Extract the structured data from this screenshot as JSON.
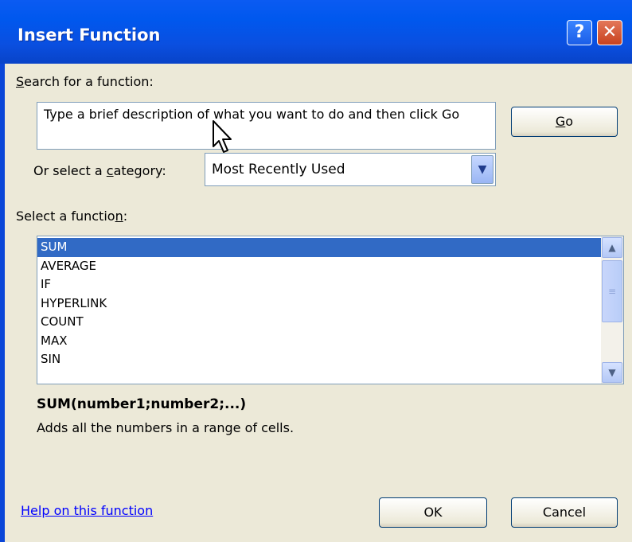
{
  "window": {
    "title": "Insert Function",
    "help_glyph": "?",
    "close_glyph": "✕"
  },
  "search": {
    "label_prefix": "",
    "label_hotkey": "S",
    "label_rest": "earch for a function:",
    "value": "Type a brief description of what you want to do and then click Go"
  },
  "go_button": {
    "hotkey": "G",
    "rest": "o"
  },
  "category": {
    "label_prefix": "Or select a ",
    "label_hotkey": "c",
    "label_rest": "ategory:",
    "selected": "Most Recently Used"
  },
  "function_list": {
    "label_prefix": "Select a functio",
    "label_hotkey": "n",
    "label_rest": ":",
    "items": [
      "SUM",
      "AVERAGE",
      "IF",
      "HYPERLINK",
      "COUNT",
      "MAX",
      "SIN"
    ],
    "selected_index": 0
  },
  "details": {
    "syntax": "SUM(number1;number2;...)",
    "description": "Adds all the numbers in a range of cells."
  },
  "footer": {
    "help_link": "Help on this function",
    "ok_label": "OK",
    "cancel_label": "Cancel"
  },
  "icons": {
    "dropdown": "chevron-down-icon",
    "scroll_up": "chevron-up-icon",
    "scroll_down": "chevron-down-icon",
    "cursor": "mouse-pointer-icon"
  },
  "colors": {
    "title_bar": "#0058ee",
    "dialog_bg": "#ece9d8",
    "selection": "#316ac5",
    "link": "#0000ff"
  }
}
